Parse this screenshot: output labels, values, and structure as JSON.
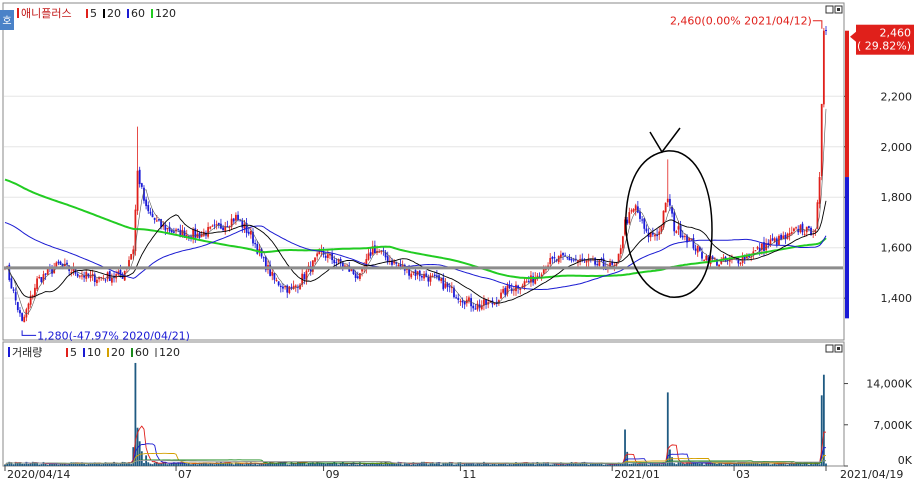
{
  "colors": {
    "up": "#e0201b",
    "down": "#1a1ad6",
    "ma5": "#000000",
    "ma20": "#000000",
    "ma60": "#1b1bd2",
    "ma120": "#22cc22",
    "baseline": "#8c8c8c",
    "annotation": "#e0201b",
    "low_annotation": "#1a1ad6"
  },
  "chart_data": [
    {
      "type": "candlestick",
      "name": "price-panel",
      "header": {
        "side_tab": "호",
        "title": "애니플러스",
        "ma_labels": [
          {
            "text": "5",
            "color": "#e0201b"
          },
          {
            "text": "20",
            "color": "#000000"
          },
          {
            "text": "60",
            "color": "#1b1bd2"
          },
          {
            "text": "120",
            "color": "#22cc22"
          }
        ]
      },
      "ylim": [
        1250,
        2550
      ],
      "yticks": [
        {
          "value": 1400,
          "label": "1,400"
        },
        {
          "value": 1600,
          "label": "1,600"
        },
        {
          "value": 1800,
          "label": "1,800"
        },
        {
          "value": 2000,
          "label": "2,000"
        },
        {
          "value": 2200,
          "label": "2,200"
        }
      ],
      "last_price": {
        "value": 2460,
        "label": "2,460",
        "change": "( 29.82%)"
      },
      "annotations": {
        "high": {
          "value": 2460,
          "text": "2,460(0.00% 2021/04/12)"
        },
        "low": {
          "value": 1280,
          "text": "1,280(-47.97% 2020/04/21)"
        }
      },
      "baseline_value": 1520,
      "keypoints": [
        [
          0,
          1540
        ],
        [
          8,
          1300
        ],
        [
          15,
          1470
        ],
        [
          25,
          1530
        ],
        [
          40,
          1480
        ],
        [
          55,
          1490
        ],
        [
          60,
          1600
        ],
        [
          62,
          1900
        ],
        [
          66,
          1750
        ],
        [
          72,
          1690
        ],
        [
          80,
          1660
        ],
        [
          90,
          1650
        ],
        [
          100,
          1680
        ],
        [
          108,
          1720
        ],
        [
          115,
          1650
        ],
        [
          120,
          1560
        ],
        [
          126,
          1470
        ],
        [
          134,
          1430
        ],
        [
          140,
          1490
        ],
        [
          148,
          1580
        ],
        [
          158,
          1530
        ],
        [
          166,
          1480
        ],
        [
          172,
          1600
        ],
        [
          180,
          1550
        ],
        [
          188,
          1510
        ],
        [
          196,
          1490
        ],
        [
          204,
          1460
        ],
        [
          212,
          1410
        ],
        [
          220,
          1370
        ],
        [
          228,
          1380
        ],
        [
          236,
          1440
        ],
        [
          246,
          1470
        ],
        [
          254,
          1540
        ],
        [
          262,
          1560
        ],
        [
          272,
          1540
        ],
        [
          280,
          1530
        ],
        [
          286,
          1520
        ],
        [
          290,
          1700
        ],
        [
          295,
          1760
        ],
        [
          300,
          1650
        ],
        [
          306,
          1660
        ],
        [
          310,
          1800
        ],
        [
          313,
          1680
        ],
        [
          318,
          1650
        ],
        [
          326,
          1570
        ],
        [
          334,
          1540
        ],
        [
          342,
          1550
        ],
        [
          350,
          1580
        ],
        [
          358,
          1620
        ],
        [
          366,
          1640
        ],
        [
          372,
          1680
        ],
        [
          376,
          1660
        ],
        [
          379,
          1680
        ],
        [
          381,
          1880
        ],
        [
          383,
          2460
        ],
        [
          384,
          2460
        ]
      ]
    },
    {
      "type": "bar",
      "name": "volume-panel",
      "header": {
        "title": "거래량",
        "ma_labels": [
          {
            "text": "5",
            "color": "#e0201b"
          },
          {
            "text": "10",
            "color": "#1b1bd2"
          },
          {
            "text": "20",
            "color": "#d4a000"
          },
          {
            "text": "60",
            "color": "#1a8a1a"
          },
          {
            "text": "120",
            "color": "#9a9a9a"
          }
        ]
      },
      "ylim": [
        0,
        18000
      ],
      "yticks": [
        {
          "value": 0,
          "label": "0K"
        },
        {
          "value": 7000,
          "label": "7,000K"
        },
        {
          "value": 14000,
          "label": "14,000K"
        }
      ],
      "spikes": [
        {
          "i": 60,
          "v": 3200
        },
        {
          "i": 61,
          "v": 17500
        },
        {
          "i": 62,
          "v": 6500
        },
        {
          "i": 63,
          "v": 4200
        },
        {
          "i": 64,
          "v": 2500
        },
        {
          "i": 66,
          "v": 1800
        },
        {
          "i": 290,
          "v": 6200
        },
        {
          "i": 291,
          "v": 2400
        },
        {
          "i": 310,
          "v": 12500
        },
        {
          "i": 311,
          "v": 2800
        },
        {
          "i": 312,
          "v": 1500
        },
        {
          "i": 382,
          "v": 12000
        },
        {
          "i": 383,
          "v": 15500
        }
      ],
      "base_volume": 420,
      "xticks": [
        {
          "index": 0,
          "label": "2020/04/14"
        },
        {
          "index": 80,
          "label": "07"
        },
        {
          "index": 149,
          "label": "09"
        },
        {
          "index": 213,
          "label": "11"
        },
        {
          "index": 284,
          "label": "2021/01"
        },
        {
          "index": 341,
          "label": "03"
        },
        {
          "index": 384,
          "label": "2021/04/19"
        }
      ]
    }
  ]
}
